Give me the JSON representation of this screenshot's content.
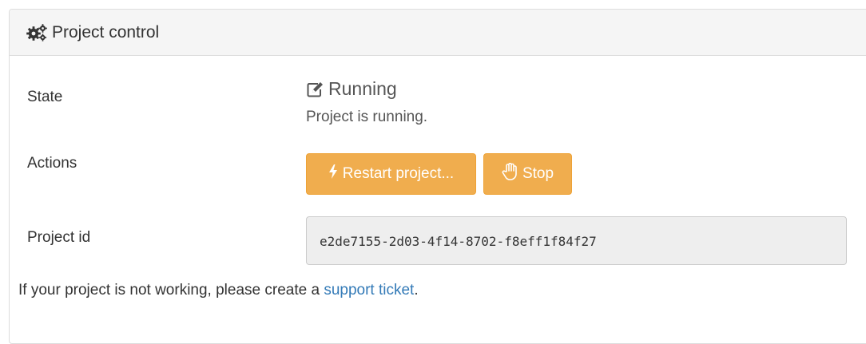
{
  "header": {
    "icon": "gears-icon",
    "title": "Project control"
  },
  "state": {
    "label": "State",
    "icon": "edit-icon",
    "value": "Running",
    "description": "Project is running."
  },
  "actions": {
    "label": "Actions",
    "restart_icon": "bolt-icon",
    "restart_label": "Restart project...",
    "stop_icon": "hand-icon",
    "stop_label": "Stop"
  },
  "project_id": {
    "label": "Project id",
    "value": "e2de7155-2d03-4f14-8702-f8eff1f84f27"
  },
  "help": {
    "prefix": "If your project is not working, please create a ",
    "link_text": "support ticket",
    "suffix": "."
  },
  "colors": {
    "warning_button": "#f0ad4e",
    "link": "#337ab7",
    "heading_bg": "#f5f5f5"
  }
}
